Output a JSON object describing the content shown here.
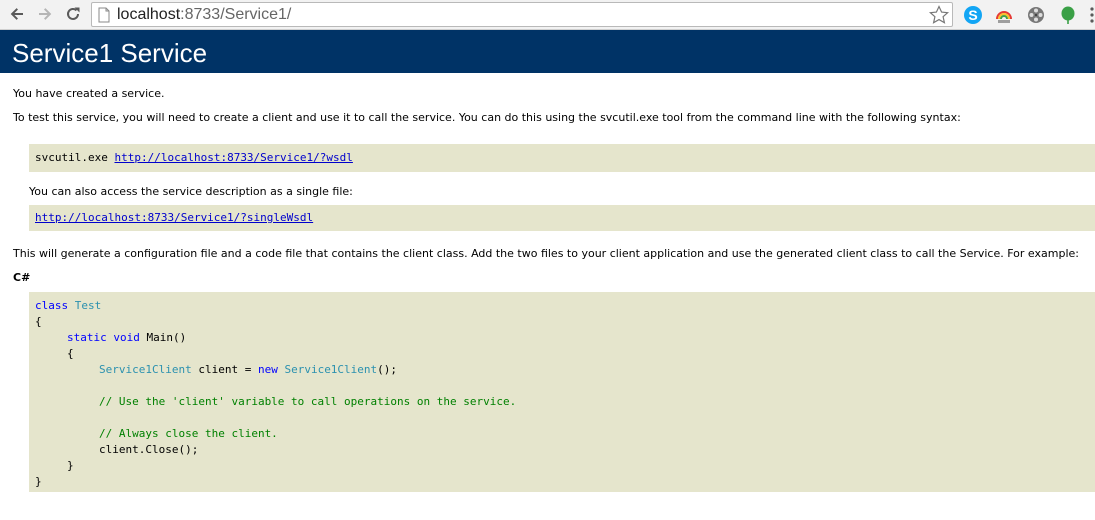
{
  "browser": {
    "url_host": "localhost",
    "url_path": ":8733/Service1/",
    "extensions": [
      "skype-icon",
      "rainbow-icon",
      "film-reel-icon",
      "leaf-icon"
    ]
  },
  "page": {
    "title": "Service1 Service",
    "intro": "You have created a service.",
    "instructions": "To test this service, you will need to create a client and use it to call the service. You can do this using the svcutil.exe tool from the command line with the following syntax:",
    "svcutil_cmd": "svcutil.exe ",
    "wsdl_link": "http://localhost:8733/Service1/?wsdl",
    "single_file_text": "You can also access the service description as a single file:",
    "single_wsdl_link": "http://localhost:8733/Service1/?singleWsdl",
    "generate_text": "This will generate a configuration file and a code file that contains the client class. Add the two files to your client application and use the generated client class to call the Service. For example:",
    "lang_label": "C#"
  },
  "code": {
    "line1_kw": "class",
    "line1_type": "Test",
    "line2": "{",
    "line3_kw": "static void",
    "line3_rest": " Main()",
    "line4": "{",
    "line5_type": "Service1Client",
    "line5_mid": " client = ",
    "line5_kw": "new",
    "line5_type2": "Service1Client",
    "line5_end": "();",
    "line7_comment": "// Use the 'client' variable to call operations on the service.",
    "line9_comment": "// Always close the client.",
    "line10": "client.Close();",
    "line11": "}",
    "line12": "}"
  },
  "colors": {
    "header_bg": "#003366",
    "code_bg": "#e5e5cc",
    "keyword": "#0000ff",
    "type": "#2b91af",
    "comment": "#008000",
    "link": "#0000cc"
  }
}
